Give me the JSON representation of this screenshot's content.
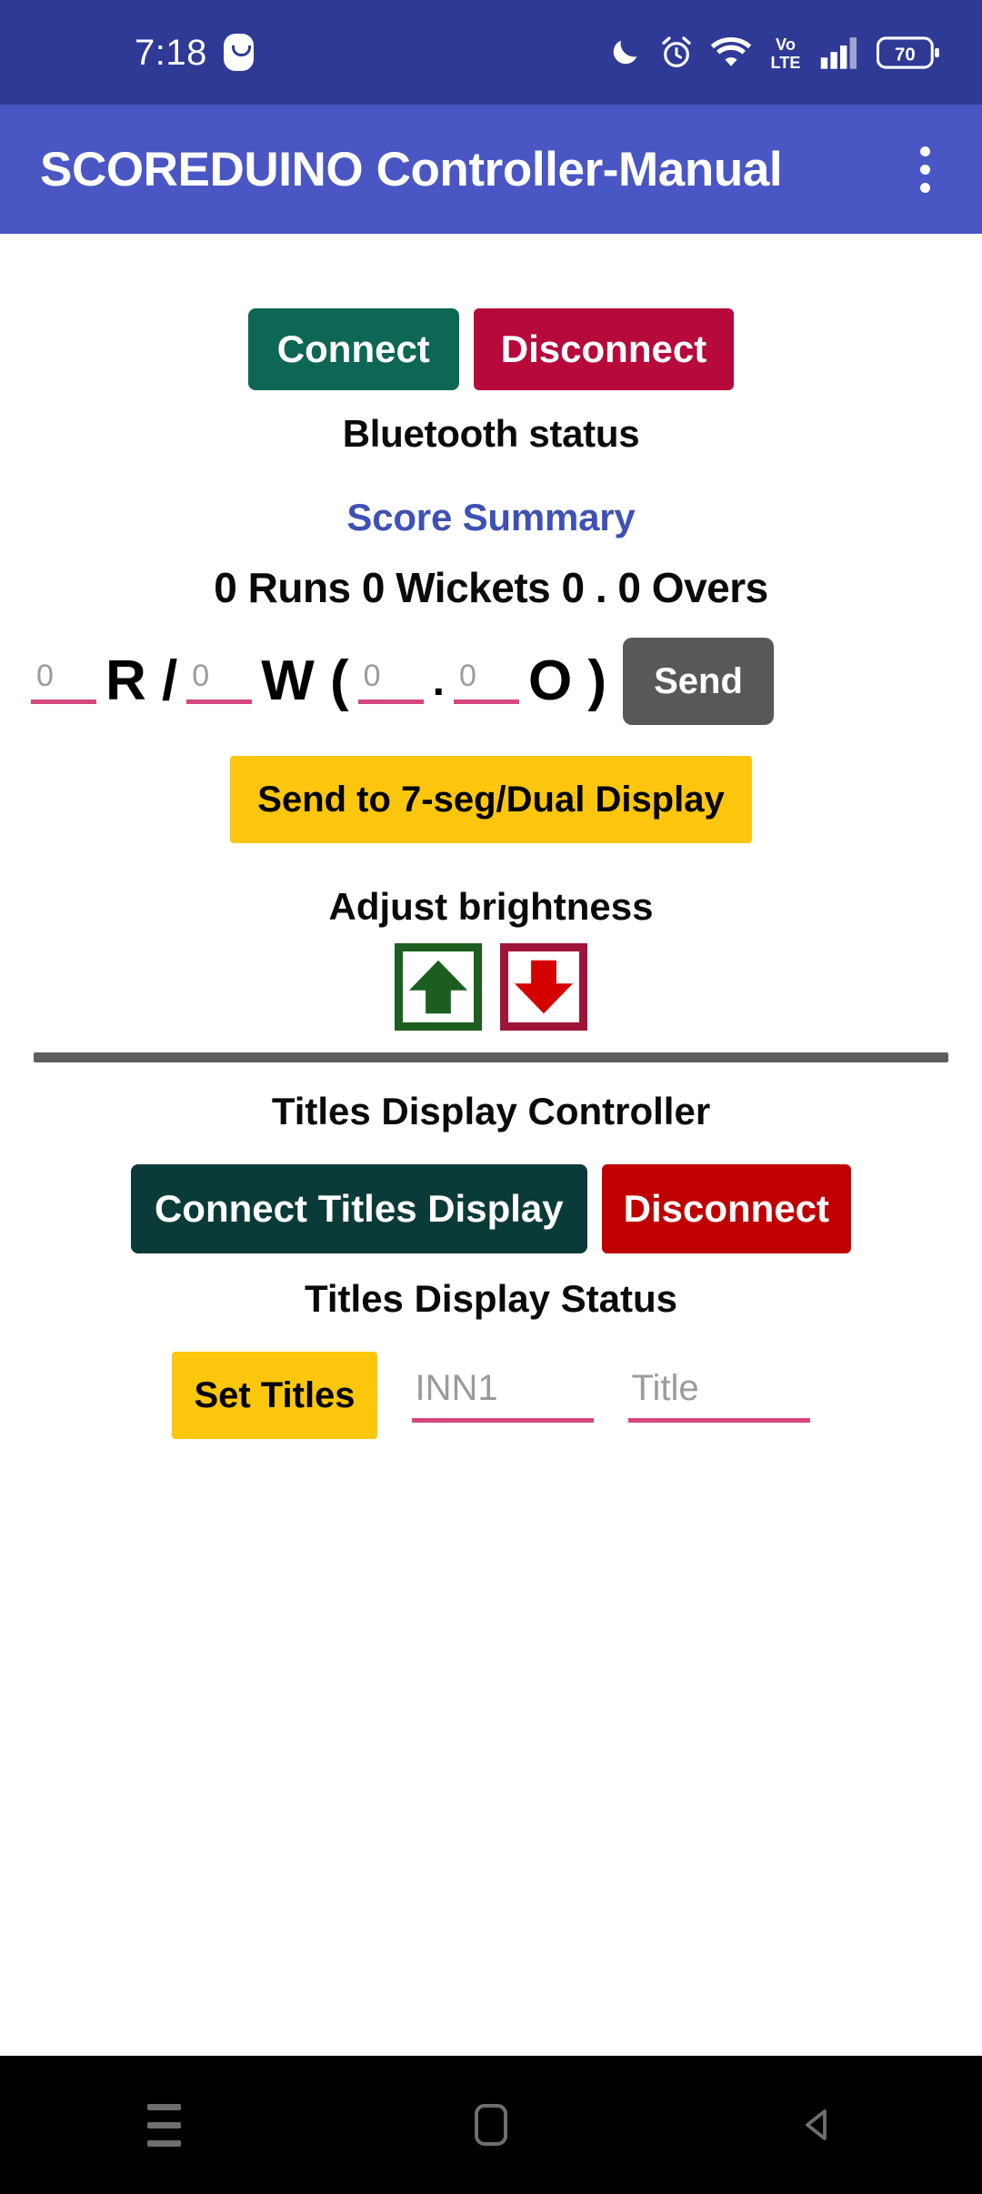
{
  "statusbar": {
    "time": "7:18",
    "battery_level": "70",
    "icons": [
      "smile-face-icon",
      "do-not-disturb-moon-icon",
      "alarm-clock-icon",
      "wifi-icon",
      "volte-icon",
      "cellular-signal-icon",
      "battery-icon"
    ],
    "volte_top": "Vo",
    "volte_bottom": "LTE"
  },
  "appbar": {
    "title": "SCOREDUINO Controller-Manual",
    "overflow_menu": "more-options"
  },
  "bluetooth": {
    "connect_label": "Connect",
    "disconnect_label": "Disconnect",
    "status_label": "Bluetooth status"
  },
  "score": {
    "summary_title": "Score Summary",
    "summary_value": "0 Runs 0 Wickets 0 . 0 Overs",
    "runs_placeholder": "0",
    "runs_value": "",
    "wickets_placeholder": "0",
    "wickets_value": "",
    "overs_placeholder": "0",
    "overs_value": "",
    "balls_placeholder": "0",
    "balls_value": "",
    "sym_runs": "R /",
    "sym_wickets": "W (",
    "sym_dot": ".",
    "sym_overs": "O )",
    "send_label": "Send",
    "seven_seg_label": "Send to 7-seg/Dual Display"
  },
  "brightness": {
    "label": "Adjust brightness",
    "up_icon": "arrow-up-icon",
    "down_icon": "arrow-down-icon",
    "up_color": "#1B5E20",
    "down_color": "#D50000"
  },
  "titles": {
    "section_title": "Titles Display Controller",
    "connect_label": "Connect Titles Display",
    "disconnect_label": "Disconnect",
    "status_label": "Titles Display Status",
    "set_titles_label": "Set Titles",
    "inn_placeholder": "INN1",
    "inn_value": "",
    "title_placeholder": "Title",
    "title_value": ""
  },
  "navbar": {
    "recents_icon": "hamburger-recents-icon",
    "home_icon": "home-icon",
    "back_icon": "back-triangle-icon"
  },
  "colors": {
    "statusbar": "#2E3A96",
    "appbar": "#4A56C4",
    "accent_yellow": "#FCC60D",
    "teal": "#0E6655",
    "crimson": "#B7093B",
    "underline_pink": "#D6477E",
    "summary_blue": "#3F51B5"
  }
}
